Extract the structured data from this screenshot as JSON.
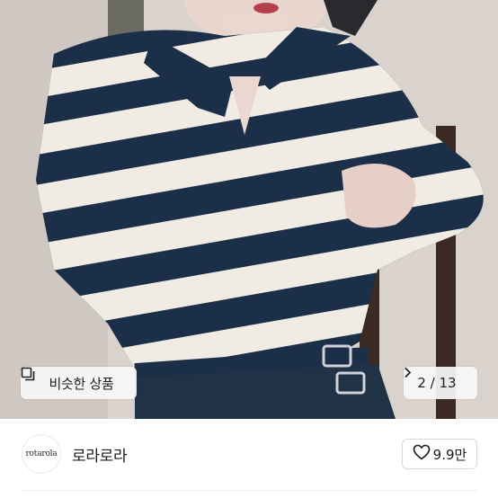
{
  "photo": {
    "description_alt": "product photo",
    "similar_button_label": "비슷한 상품",
    "page_indicator": "2 / 13",
    "colors": {
      "navy": "#1c2f48",
      "cream": "#f1ece3",
      "background": "#d8d1cc",
      "chair": "#3a2a22"
    }
  },
  "seller": {
    "avatar_logo_text": "rotarola",
    "name": "로라로라",
    "like_count": "9.9만"
  },
  "icons": {
    "similar": "copy-squares-icon",
    "next": "chevron-right-icon",
    "like": "heart-outline-icon"
  }
}
